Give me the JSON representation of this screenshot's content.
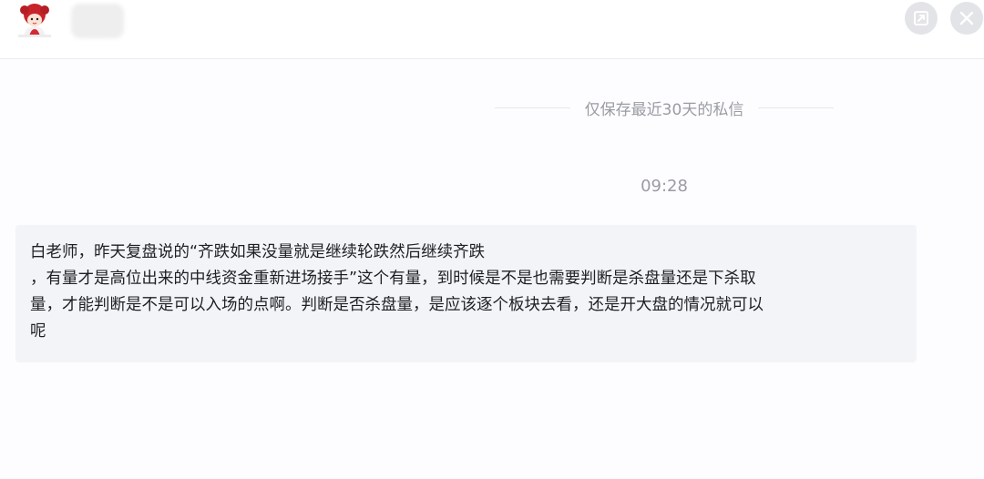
{
  "header": {
    "avatar_icon": "cartoon-girl-avatar",
    "share_icon": "share-square-icon",
    "close_icon": "close-icon"
  },
  "chat": {
    "retention_notice": "仅保存最近30天的私信",
    "timestamp": "09:28",
    "message_lines": [
      "白老师，昨天复盘说的“齐跌如果没量就是继续轮跌然后继续齐跌",
      "，有量才是高位出来的中线资金重新进场接手”这个有量，到时候是不是也需要判断是杀盘量还是下杀取",
      "量，才能判断是不是可以入场的点啊。判断是否杀盘量，是应该逐个板块去看，还是开大盘的情况就可以",
      "呢"
    ]
  },
  "colors": {
    "bubble_bg": "#f3f4f8",
    "notice_text": "#9a9ca3",
    "message_text": "#1e1f23"
  }
}
